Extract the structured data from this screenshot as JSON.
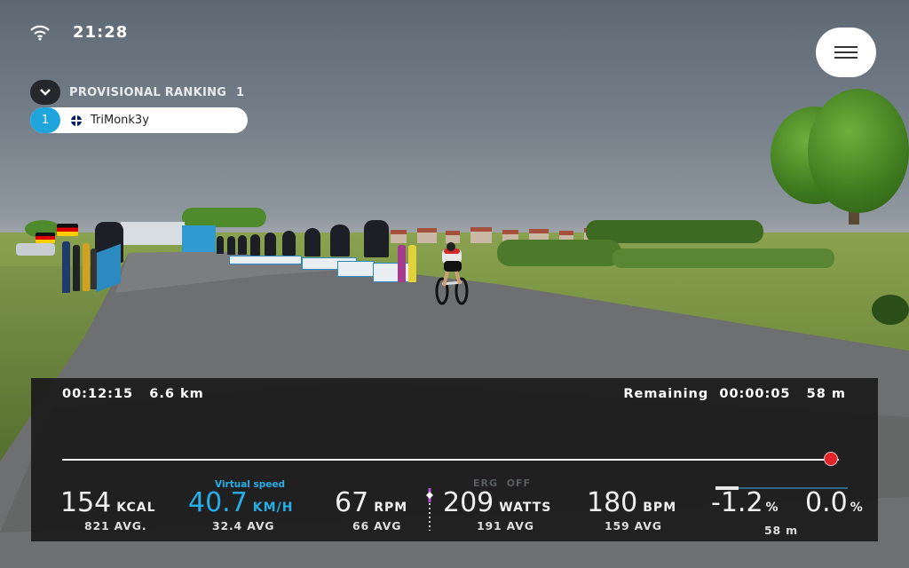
{
  "status_bar": {
    "time": "21:28"
  },
  "ranking": {
    "title": "PROVISIONAL RANKING",
    "count": "1",
    "entries": [
      {
        "position": "1",
        "name": "TriMonk3y"
      }
    ]
  },
  "hud": {
    "elapsed_time": "00:12:15",
    "distance": "6.6 km",
    "remaining_label": "Remaining",
    "remaining_time": "00:00:05",
    "remaining_distance": "58 m",
    "progress": 0.99,
    "calories": {
      "value": "154",
      "unit": "KCAL",
      "avg": "821 AVG."
    },
    "speed": {
      "label": "Virtual speed",
      "value": "40.7",
      "unit": "KM/H",
      "avg": "32.4 AVG"
    },
    "cadence": {
      "value": "67",
      "unit": "RPM",
      "avg": "66 AVG"
    },
    "erg": {
      "label": "ERG",
      "state": "OFF"
    },
    "power": {
      "value": "209",
      "unit": "WATTS",
      "avg": "191 AVG"
    },
    "heart_rate": {
      "value": "180",
      "unit": "BPM",
      "avg": "159 AVG"
    },
    "slope": {
      "current": "-1.2",
      "current_unit": "%",
      "next": "0.0",
      "next_unit": "%",
      "distance": "58 m"
    }
  },
  "colors": {
    "accent": "#27aee6",
    "rank_badge": "#1fa5dc",
    "progress_marker": "#e3242b",
    "panel": "#1c1c1e"
  }
}
